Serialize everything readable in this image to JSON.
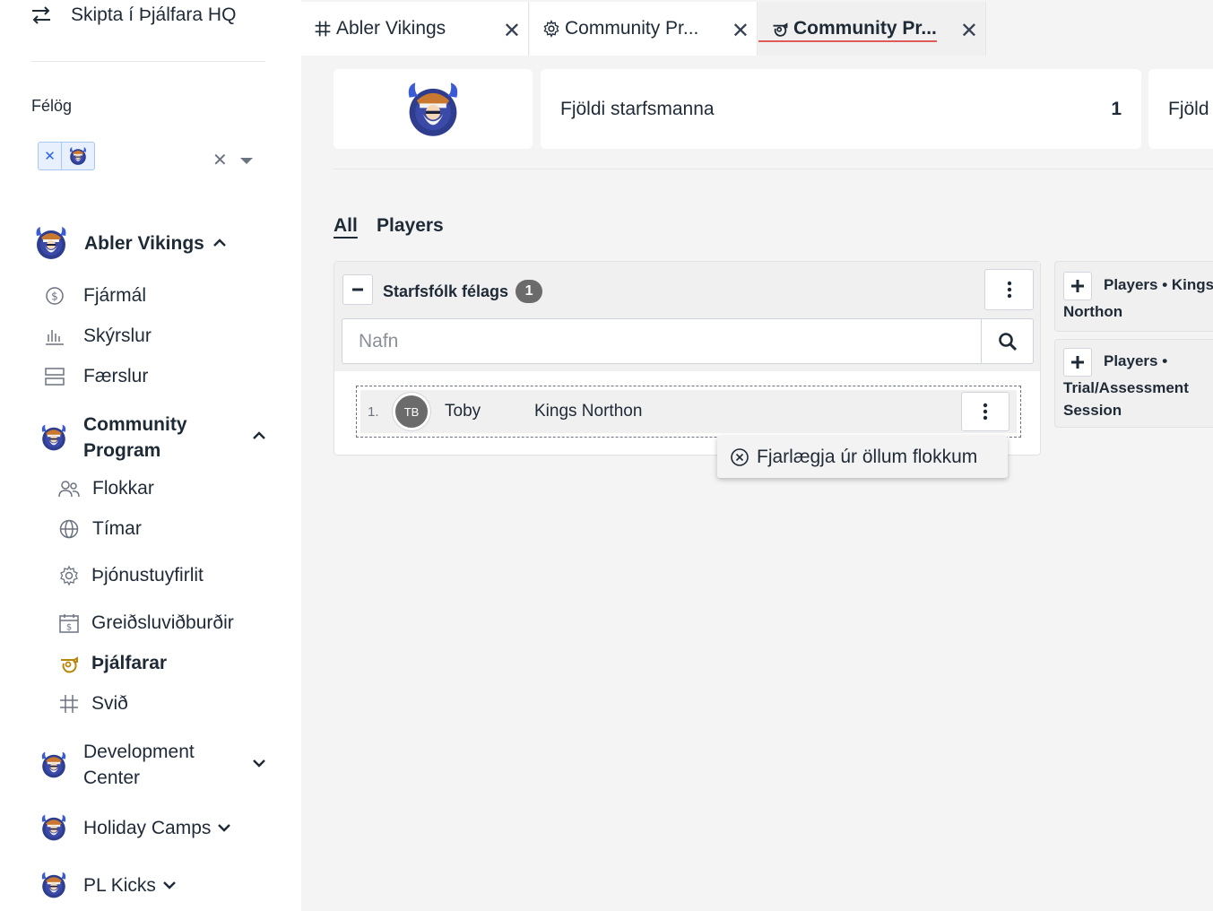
{
  "sidebar": {
    "switch_label": "Skipta í Þjálfara HQ",
    "clubs_label": "Félög",
    "orgs": [
      {
        "name": "Abler Vikings",
        "items": [
          "Fjármál",
          "Skýrslur",
          "Færslur"
        ]
      },
      {
        "name_line1": "Community",
        "name_line2": "Program",
        "items": [
          "Flokkar",
          "Tímar",
          "Þjónustuyfirlit",
          "Greiðsluviðburðir",
          "Þjálfarar",
          "Svið"
        ]
      },
      {
        "name_line1": "Development",
        "name_line2": "Center"
      },
      {
        "name": "Holiday Camps"
      },
      {
        "name": "PL Kicks"
      }
    ],
    "active_item": "Þjálfarar"
  },
  "tabs": [
    {
      "label": "Abler Vikings"
    },
    {
      "label": "Community Pr..."
    },
    {
      "label": "Community Pr..."
    }
  ],
  "stats": {
    "staff_label": "Fjöldi starfsmanna",
    "staff_value": "1",
    "next_label": "Fjöld"
  },
  "filters": [
    "All",
    "Players"
  ],
  "group": {
    "title": "Starfsfólk félags",
    "count": "1",
    "search_placeholder": "Nafn",
    "members": [
      {
        "num": "1.",
        "initials": "TB",
        "name": "Toby",
        "team": "Kings Northon"
      }
    ]
  },
  "popover": {
    "label": "Fjarlægja úr öllum flokkum"
  },
  "side_groups": [
    {
      "line1": "Players • Kings",
      "line2": "Northon"
    },
    {
      "line1": "Players •",
      "line2": "Trial/Assessment",
      "line3": "Session"
    }
  ],
  "colors": {
    "accent_underline": "#e05a5a",
    "badge": "#6b6b6b",
    "whistle": "#b8860b"
  }
}
